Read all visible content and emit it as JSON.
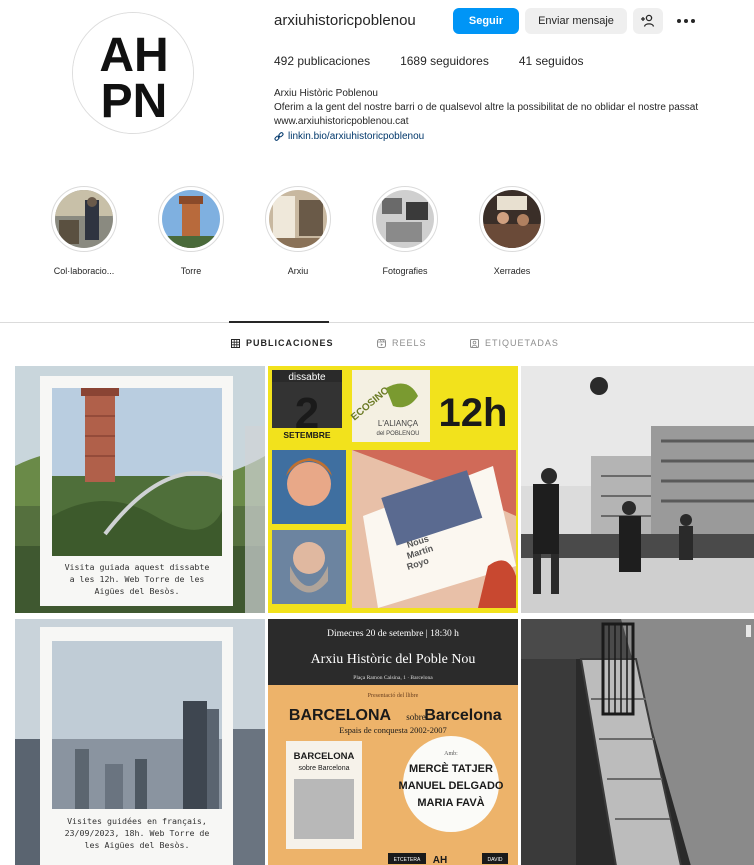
{
  "profile": {
    "username": "arxiuhistoricpoblenou",
    "follow_label": "Seguir",
    "message_label": "Enviar mensaje",
    "add_icon": "person-plus-icon",
    "more_icon": "ellipsis-icon",
    "avatar_text_top": "AH",
    "avatar_text_bottom": "PN",
    "stats": {
      "posts": "492 publicaciones",
      "followers": "1689 seguidores",
      "following": "41 seguidos"
    },
    "full_name": "Arxiu Històric Poblenou",
    "bio": "Oferim a la gent del nostre barri o de qualsevol altre la possibilitat de no oblidar el nostre passat",
    "website": "www.arxiuhistoricpoblenou.cat",
    "link": "linkin.bio/arxiuhistoricpoblenou"
  },
  "highlights": [
    {
      "label": "Col·laboracio..."
    },
    {
      "label": "Torre"
    },
    {
      "label": "Arxiu"
    },
    {
      "label": "Fotografies"
    },
    {
      "label": "Xerrades"
    }
  ],
  "tabs": [
    {
      "label": "PUBLICACIONES"
    },
    {
      "label": "REELS"
    },
    {
      "label": "ETIQUETADAS"
    }
  ],
  "posts": {
    "p1": {
      "caption_1": "Visita guiada aquest dissabte",
      "caption_2": "a les 12h. Web Torre de les",
      "caption_3": "Aigües del Besòs."
    },
    "p2": {
      "day_label": "dissabte",
      "day_number": "2",
      "month": "SETEMBRE",
      "hour": "12h",
      "logo_1": "ECOSINO",
      "logo_2": "L'ALIANÇA",
      "logo_3": "del POBLENOU",
      "book_1": "Nous",
      "book_2": "Martín",
      "book_3": "Royo"
    },
    "p4": {
      "caption_1": "Visites guidées en français,",
      "caption_2": "23/09/2023, 18h. Web Torre de",
      "caption_3": "les Aigües del Besòs."
    },
    "p5": {
      "date_line": "Dimecres 20 de setembre  |  18:30 h",
      "org": "Arxiu Històric del Poble Nou",
      "address": "Plaça Ramon Calsina, 1 · Barcelona",
      "presentation": "Presentació del llibre",
      "book_title_a": "BARCELONA",
      "book_title_b": "sobre",
      "book_title_c": "Barcelona",
      "book_subtitle": "Espais de conquesta 2002-2007",
      "cover_1": "BARCELONA",
      "cover_2": "sobre Barcelona",
      "amb": "Amb:",
      "name_1": "MERCÈ TATJER",
      "name_2": "MANUEL DELGADO",
      "name_3": "MARIA FAVÀ",
      "footer_1": "ETCETERA",
      "footer_2": "AH",
      "footer_3": "DAVID"
    }
  }
}
